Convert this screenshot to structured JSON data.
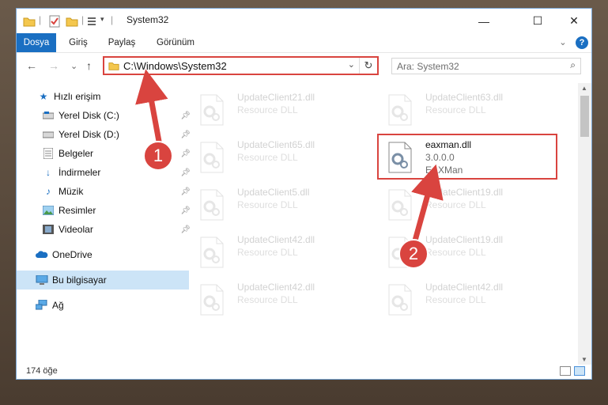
{
  "window": {
    "title": "System32",
    "minimize": "—",
    "maximize": "☐",
    "close": "✕"
  },
  "ribbon": {
    "tabs": [
      "Dosya",
      "Giriş",
      "Paylaş",
      "Görünüm"
    ],
    "collapse": "⌄",
    "help": "?"
  },
  "nav": {
    "back": "←",
    "forward": "→",
    "recent": "⌄",
    "up": "↑",
    "address": "C:\\Windows\\System32",
    "address_chevron": "⌄",
    "refresh": "↻",
    "search_placeholder": "Ara: System32",
    "search_icon": "⌕"
  },
  "navpane": {
    "items": [
      {
        "label": "Hızlı erişim",
        "icon": "star-icon",
        "pinned": false
      },
      {
        "label": "Yerel Disk (C:)",
        "icon": "drive-icon",
        "pinned": true
      },
      {
        "label": "Yerel Disk (D:)",
        "icon": "drive-icon",
        "pinned": true
      },
      {
        "label": "Belgeler",
        "icon": "documents-icon",
        "pinned": true
      },
      {
        "label": "İndirmeler",
        "icon": "download-icon",
        "pinned": true
      },
      {
        "label": "Müzik",
        "icon": "music-icon",
        "pinned": true
      },
      {
        "label": "Resimler",
        "icon": "pictures-icon",
        "pinned": true
      },
      {
        "label": "Videolar",
        "icon": "video-icon",
        "pinned": true
      },
      {
        "label": "OneDrive",
        "icon": "cloud-icon",
        "pinned": false
      },
      {
        "label": "Bu bilgisayar",
        "icon": "computer-icon",
        "pinned": false,
        "selected": true
      },
      {
        "label": "Ağ",
        "icon": "network-icon",
        "pinned": false
      }
    ]
  },
  "files": [
    {
      "name": "UpdateClient21.dll",
      "desc": "Resource DLL"
    },
    {
      "name": "UpdateClient63.dll",
      "desc": "Resource DLL"
    },
    {
      "name": "UpdateClient65.dll",
      "desc": "Resource DLL"
    },
    {
      "name": "eaxman.dll",
      "desc": "3.0.0.0",
      "desc2": "EAXMan",
      "highlighted": true
    },
    {
      "name": "UpdateClient5.dll",
      "desc": "Resource DLL"
    },
    {
      "name": "UpdateClient19.dll",
      "desc": "Resource DLL"
    },
    {
      "name": "UpdateClient42.dll",
      "desc": "Resource DLL"
    },
    {
      "name": "UpdateClient19.dll",
      "desc": "Resource DLL"
    },
    {
      "name": "UpdateClient42.dll",
      "desc": "Resource DLL"
    },
    {
      "name": "UpdateClient42.dll",
      "desc": "Resource DLL"
    }
  ],
  "status": {
    "count": "174 öğe"
  },
  "annotations": {
    "step1": "1",
    "step2": "2"
  },
  "colors": {
    "accent": "#1a6fc2",
    "annotation": "#d9443f",
    "selection": "#cce4f7"
  }
}
